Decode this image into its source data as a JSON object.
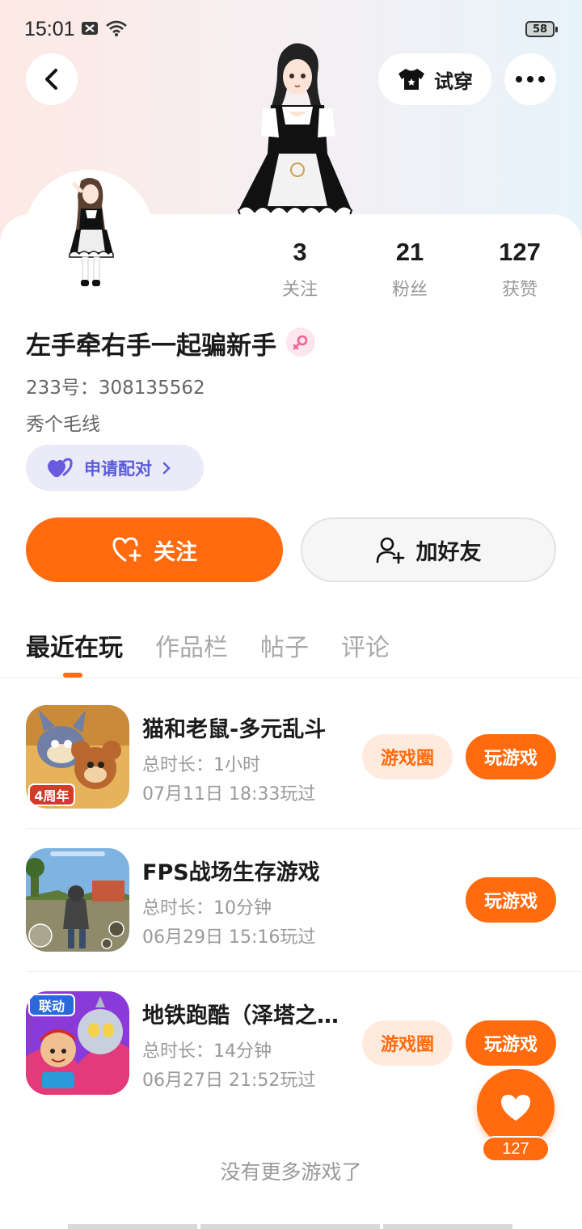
{
  "status_bar": {
    "time": "15:01",
    "battery": "58"
  },
  "header": {
    "try_on_label": "试穿"
  },
  "profile": {
    "stats": [
      {
        "value": "3",
        "label": "关注"
      },
      {
        "value": "21",
        "label": "粉丝"
      },
      {
        "value": "127",
        "label": "获赞"
      }
    ],
    "username": "左手牵右手一起骗新手",
    "uid": "233号：308135562",
    "bio": "秀个毛线",
    "pair_label": "申请配对",
    "follow_label": "关注",
    "add_friend_label": "加好友"
  },
  "tabs": [
    {
      "label": "最近在玩",
      "active": true
    },
    {
      "label": "作品栏",
      "active": false
    },
    {
      "label": "帖子",
      "active": false
    },
    {
      "label": "评论",
      "active": false
    }
  ],
  "games": [
    {
      "title": "猫和老鼠-多元乱斗",
      "duration": "总时长：1小时",
      "last_played": "07月11日 18:33玩过",
      "circle_label": "游戏圈",
      "play_label": "玩游戏"
    },
    {
      "title": "FPS战场生存游戏",
      "duration": "总时长：10分钟",
      "last_played": "06月29日 15:16玩过",
      "play_label": "玩游戏"
    },
    {
      "title": "地铁跑酷（泽塔之…",
      "duration": "总时长：14分钟",
      "last_played": "06月27日 21:52玩过",
      "circle_label": "游戏圈",
      "play_label": "玩游戏"
    }
  ],
  "game_icon_texts": {
    "tom_jerry_badge": "4周年",
    "subway_badge": "联动"
  },
  "like_count": "127",
  "footer": {
    "no_more": "没有更多游戏了"
  },
  "colors": {
    "accent": "#ff6b0e",
    "pair": "#5a5bd8",
    "gender": "#f06292"
  }
}
